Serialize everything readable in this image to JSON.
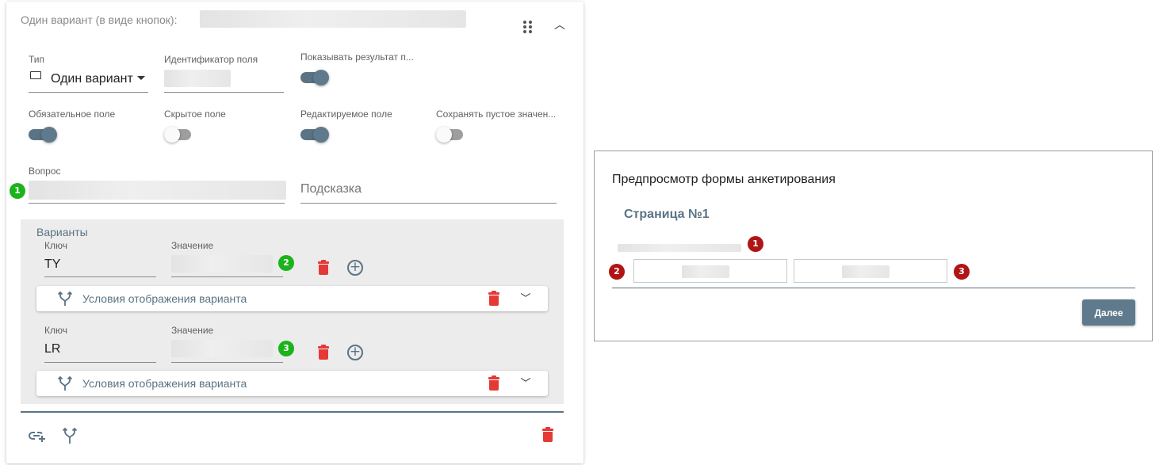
{
  "editor": {
    "title": "Один вариант (в виде кнопок):",
    "type": {
      "label": "Тип",
      "value": "Один вариант"
    },
    "field_id": {
      "label": "Идентификатор поля"
    },
    "show_result": {
      "label": "Показывать результат п...",
      "checked": true
    },
    "required": {
      "label": "Обязательное поле",
      "checked": true
    },
    "hidden": {
      "label": "Скрытое поле",
      "checked": false
    },
    "editable": {
      "label": "Редактируемое поле",
      "checked": true
    },
    "save_empty": {
      "label": "Сохранять пустое значен...",
      "checked": false
    },
    "question": {
      "label": "Вопрос"
    },
    "hint": {
      "placeholder": "Подсказка"
    },
    "variants": {
      "title": "Варианты",
      "items": [
        {
          "key_label": "Ключ",
          "key": "TY",
          "value_label": "Значение",
          "badge": "2",
          "conditions_label": "Условия отображения варианта"
        },
        {
          "key_label": "Ключ",
          "key": "LR",
          "value_label": "Значение",
          "badge": "3",
          "conditions_label": "Условия отображения варианта"
        }
      ]
    },
    "badges": {
      "question": "1"
    }
  },
  "preview": {
    "title": "Предпросмотр формы анкетирования",
    "page": "Страница №1",
    "badges": [
      "1",
      "2",
      "3"
    ],
    "next_button": "Далее"
  },
  "colors": {
    "accent": "#5a7385",
    "delete": "#e53935",
    "badge_green": "#1bb31b",
    "badge_red": "#b01414"
  }
}
